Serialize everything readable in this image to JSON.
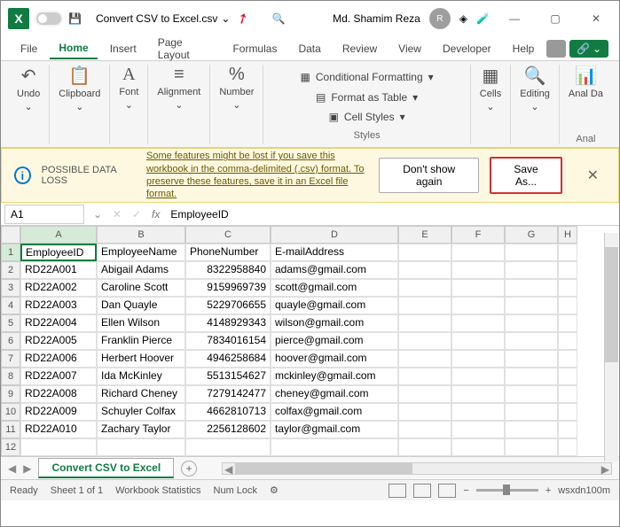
{
  "titlebar": {
    "doc_name": "Convert CSV to Excel.csv",
    "user_name": "Md. Shamim Reza",
    "user_initials": "R"
  },
  "tabs": [
    "File",
    "Home",
    "Insert",
    "Page Layout",
    "Formulas",
    "Data",
    "Review",
    "View",
    "Developer",
    "Help"
  ],
  "active_tab": "Home",
  "ribbon": {
    "undo": "Undo",
    "clipboard": "Clipboard",
    "font": "Font",
    "alignment": "Alignment",
    "number": "Number",
    "cond_fmt": "Conditional Formatting",
    "fmt_table": "Format as Table",
    "cell_styles": "Cell Styles",
    "styles": "Styles",
    "cells": "Cells",
    "editing": "Editing",
    "analyze": "Anal Da",
    "anal_label": "Anal"
  },
  "warning": {
    "title": "POSSIBLE DATA LOSS",
    "msg": "Some features might be lost if you save this workbook in the comma-delimited (.csv) format. To preserve these features, save it in an Excel file format.",
    "dont_show": "Don't show again",
    "save_as": "Save As..."
  },
  "formula_bar": {
    "name_box": "A1",
    "formula": "EmployeeID"
  },
  "columns": [
    "A",
    "B",
    "C",
    "D",
    "E",
    "F",
    "G",
    "H"
  ],
  "headers": [
    "EmployeeID",
    "EmployeeName",
    "PhoneNumber",
    "E-mailAddress"
  ],
  "rows": [
    [
      "RD22A001",
      "Abigail Adams",
      "8322958840",
      "adams@gmail.com"
    ],
    [
      "RD22A002",
      "Caroline Scott",
      "9159969739",
      "scott@gmail.com"
    ],
    [
      "RD22A003",
      "Dan Quayle",
      "5229706655",
      "quayle@gmail.com"
    ],
    [
      "RD22A004",
      "Ellen Wilson",
      "4148929343",
      "wilson@gmail.com"
    ],
    [
      "RD22A005",
      "Franklin Pierce",
      "7834016154",
      "pierce@gmail.com"
    ],
    [
      "RD22A006",
      "Herbert Hoover",
      "4946258684",
      "hoover@gmail.com"
    ],
    [
      "RD22A007",
      "Ida McKinley",
      "5513154627",
      "mckinley@gmail.com"
    ],
    [
      "RD22A008",
      "Richard Cheney",
      "7279142477",
      "cheney@gmail.com"
    ],
    [
      "RD22A009",
      "Schuyler Colfax",
      "4662810713",
      "colfax@gmail.com"
    ],
    [
      "RD22A010",
      "Zachary Taylor",
      "2256128602",
      "taylor@gmail.com"
    ]
  ],
  "sheet": {
    "name": "Convert CSV to Excel"
  },
  "status": {
    "ready": "Ready",
    "sheet_info": "Sheet 1 of 1",
    "wb_stats": "Workbook Statistics",
    "numlock": "Num Lock",
    "zoom": "wsxdn100m"
  }
}
